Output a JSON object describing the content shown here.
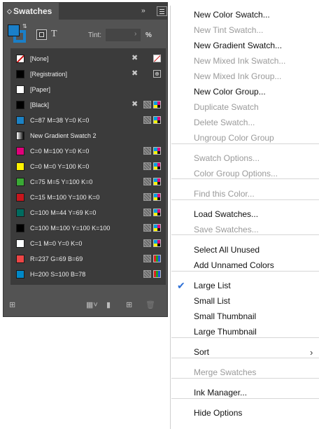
{
  "panel": {
    "tab_title": "Swatches",
    "collapse_glyph": "››",
    "tint_label": "Tint:",
    "tint_value": "",
    "tint_unit": "%",
    "text_button": "T",
    "fill_color": "#1a7fc8"
  },
  "swatches": [
    {
      "label": "[None]",
      "chip": "none",
      "no_edit": true,
      "icon": "none"
    },
    {
      "label": "[Registration]",
      "chip": "#000000",
      "no_edit": true,
      "icon": "registration"
    },
    {
      "label": "[Paper]",
      "chip": "#ffffff",
      "no_edit": false,
      "icon": ""
    },
    {
      "label": "[Black]",
      "chip": "#000000",
      "no_edit": true,
      "icon": "cmyk"
    },
    {
      "label": "C=87 M=38 Y=0 K=0",
      "chip": "#1c82c4",
      "no_edit": false,
      "icon": "cmyk"
    },
    {
      "label": "New Gradient Swatch 2",
      "chip": "gradient",
      "no_edit": false,
      "icon": ""
    },
    {
      "label": "C=0 M=100 Y=0 K=0",
      "chip": "#e0007a",
      "no_edit": false,
      "icon": "cmyk"
    },
    {
      "label": "C=0 M=0 Y=100 K=0",
      "chip": "#fff200",
      "no_edit": false,
      "icon": "cmyk"
    },
    {
      "label": "C=75 M=5 Y=100 K=0",
      "chip": "#3aa935",
      "no_edit": false,
      "icon": "cmyk"
    },
    {
      "label": "C=15 M=100 Y=100 K=0",
      "chip": "#c8161d",
      "no_edit": false,
      "icon": "cmyk"
    },
    {
      "label": "C=100 M=44 Y=69 K=0",
      "chip": "#006b5f",
      "no_edit": false,
      "icon": "cmyk"
    },
    {
      "label": "C=100 M=100 Y=100 K=100",
      "chip": "#000000",
      "no_edit": false,
      "icon": "cmyk"
    },
    {
      "label": "C=1 M=0 Y=0 K=0",
      "chip": "#fcfeff",
      "no_edit": false,
      "icon": "cmyk"
    },
    {
      "label": "R=237 G=69 B=69",
      "chip": "#ed4545",
      "no_edit": false,
      "icon": "rgb"
    },
    {
      "label": "H=200 S=100 B=78",
      "chip": "#0088c7",
      "no_edit": false,
      "icon": "rgb"
    }
  ],
  "menu": {
    "items": [
      {
        "label": "New Color Swatch...",
        "enabled": true
      },
      {
        "label": "New Tint Swatch...",
        "enabled": false
      },
      {
        "label": "New Gradient Swatch...",
        "enabled": true
      },
      {
        "label": "New Mixed Ink Swatch...",
        "enabled": false
      },
      {
        "label": "New Mixed Ink Group...",
        "enabled": false
      },
      {
        "label": "New Color Group...",
        "enabled": true
      },
      {
        "label": "Duplicate Swatch",
        "enabled": false
      },
      {
        "label": "Delete Swatch...",
        "enabled": false
      },
      {
        "label": "Ungroup Color Group",
        "enabled": false
      },
      {
        "label": "Swatch Options...",
        "enabled": false
      },
      {
        "label": "Color Group Options...",
        "enabled": false
      },
      {
        "label": "Find this Color...",
        "enabled": false
      },
      {
        "label": "Load Swatches...",
        "enabled": true
      },
      {
        "label": "Save Swatches...",
        "enabled": false
      },
      {
        "label": "Select All Unused",
        "enabled": true
      },
      {
        "label": "Add Unnamed Colors",
        "enabled": true
      },
      {
        "label": "Large List",
        "enabled": true,
        "checked": true
      },
      {
        "label": "Small List",
        "enabled": true
      },
      {
        "label": "Small Thumbnail",
        "enabled": true
      },
      {
        "label": "Large Thumbnail",
        "enabled": true
      },
      {
        "label": "Sort",
        "enabled": true,
        "submenu": true
      },
      {
        "label": "Merge Swatches",
        "enabled": false
      },
      {
        "label": "Ink Manager...",
        "enabled": true
      },
      {
        "label": "Hide Options",
        "enabled": true
      }
    ],
    "check_glyph": "✔",
    "submenu_glyph": "›"
  }
}
